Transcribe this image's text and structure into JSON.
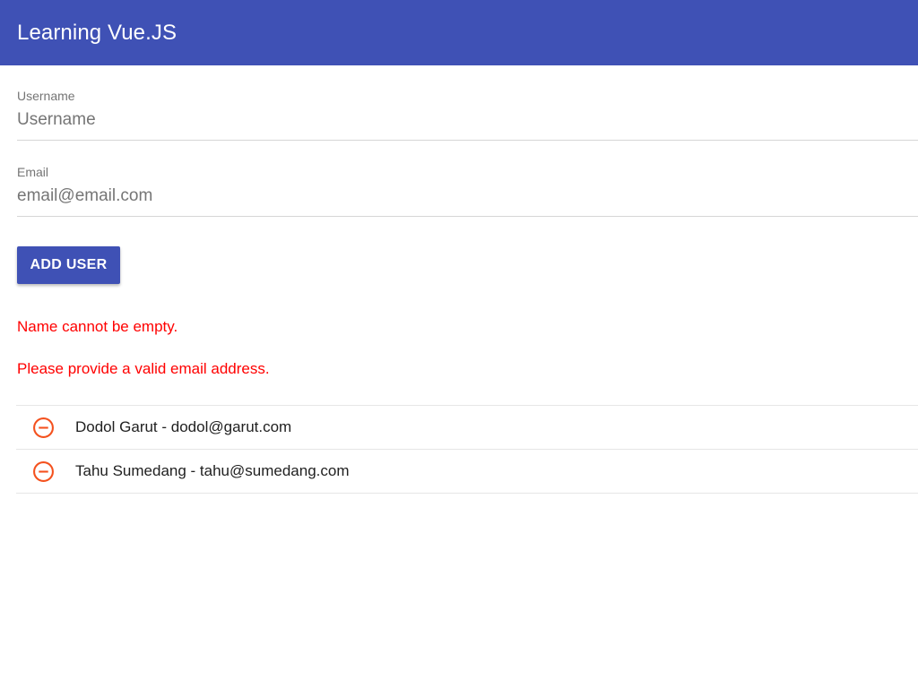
{
  "app": {
    "title": "Learning Vue.JS"
  },
  "form": {
    "username": {
      "label": "Username",
      "placeholder": "Username",
      "value": ""
    },
    "email": {
      "label": "Email",
      "placeholder": "email@email.com",
      "value": ""
    },
    "add_button_label": "ADD USER"
  },
  "errors": {
    "name": "Name cannot be empty.",
    "email": "Please provide a valid email address."
  },
  "users": [
    {
      "text": "Dodol Garut - dodol@garut.com",
      "icon": "remove-circle-icon"
    },
    {
      "text": "Tahu Sumedang - tahu@sumedang.com",
      "icon": "remove-circle-icon"
    }
  ],
  "colors": {
    "primary": "#3f51b5",
    "error": "#ff0000",
    "remove_icon": "#f4511e"
  }
}
